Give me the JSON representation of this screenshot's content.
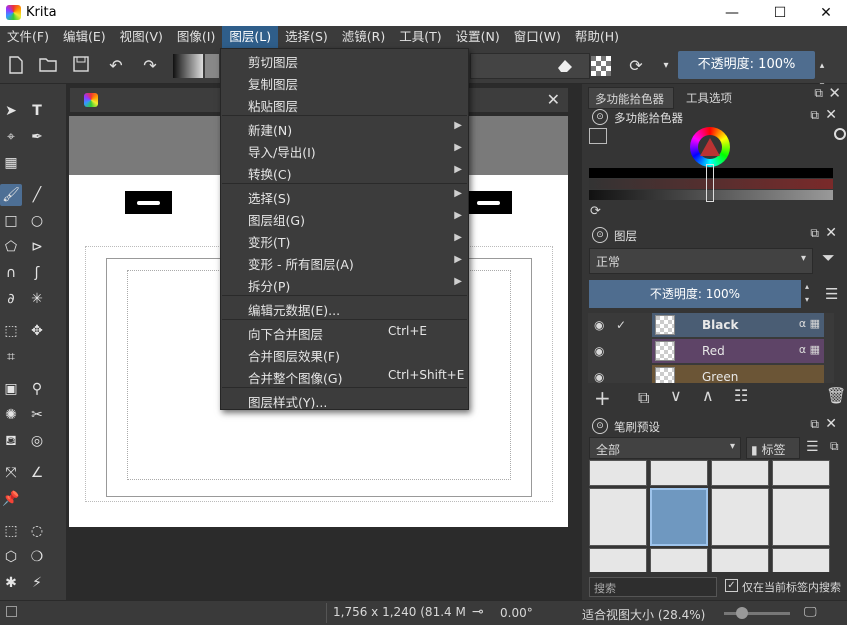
{
  "window": {
    "title": "Krita",
    "minimize": "—",
    "maximize": "☐",
    "close": "✕"
  },
  "menubar": [
    {
      "label": "文件(F)",
      "active": false
    },
    {
      "label": "编辑(E)",
      "active": false
    },
    {
      "label": "视图(V)",
      "active": false
    },
    {
      "label": "图像(I)",
      "active": false
    },
    {
      "label": "图层(L)",
      "active": true
    },
    {
      "label": "选择(S)",
      "active": false
    },
    {
      "label": "滤镜(R)",
      "active": false
    },
    {
      "label": "工具(T)",
      "active": false
    },
    {
      "label": "设置(N)",
      "active": false
    },
    {
      "label": "窗口(W)",
      "active": false
    },
    {
      "label": "帮助(H)",
      "active": false
    }
  ],
  "toolbar": {
    "opacity_label": "不透明度: 100%"
  },
  "layer_menu": {
    "items": [
      {
        "label": "剪切图层",
        "shortcut": "",
        "submenu": false
      },
      {
        "label": "复制图层",
        "shortcut": "",
        "submenu": false
      },
      {
        "label": "粘贴图层",
        "shortcut": "",
        "submenu": false
      },
      {
        "label": "新建(N)",
        "shortcut": "",
        "submenu": true
      },
      {
        "label": "导入/导出(I)",
        "shortcut": "",
        "submenu": true
      },
      {
        "label": "转换(C)",
        "shortcut": "",
        "submenu": true
      },
      {
        "label": "选择(S)",
        "shortcut": "",
        "submenu": true
      },
      {
        "label": "图层组(G)",
        "shortcut": "",
        "submenu": true
      },
      {
        "label": "变形(T)",
        "shortcut": "",
        "submenu": true
      },
      {
        "label": "变形 - 所有图层(A)",
        "shortcut": "",
        "submenu": true
      },
      {
        "label": "拆分(P)",
        "shortcut": "",
        "submenu": true
      },
      {
        "label": "编辑元数据(E)...",
        "shortcut": "",
        "submenu": false
      },
      {
        "label": "向下合并图层",
        "shortcut": "Ctrl+E",
        "submenu": false
      },
      {
        "label": "合并图层效果(F)",
        "shortcut": "",
        "submenu": false
      },
      {
        "label": "合并整个图像(G)",
        "shortcut": "Ctrl+Shift+E",
        "submenu": false
      },
      {
        "label": "图层样式(Y)...",
        "shortcut": "",
        "submenu": false
      }
    ]
  },
  "dock": {
    "tabs": [
      "多功能拾色器",
      "工具选项"
    ],
    "color_panel_title": "多功能拾色器",
    "layers_panel_title": "图层",
    "blend_mode": "正常",
    "layer_opacity": "不透明度: 100%",
    "layers": [
      {
        "name": "Black",
        "color": "#4a5d74"
      },
      {
        "name": "Red",
        "color": "#5e4467"
      },
      {
        "name": "Green",
        "color": "#6b5536"
      }
    ],
    "brush_panel_title": "笔刷预设",
    "brush_filter": "全部",
    "brush_tag_label": "标签",
    "search_placeholder": "搜索",
    "only_current_tag_label": "仅在当前标签内搜索"
  },
  "statusbar": {
    "size": "1,756 x 1,240 (81.4 MiB)",
    "rotation": "0.00°",
    "zoom": "适合视图大小 (28.4%)"
  }
}
